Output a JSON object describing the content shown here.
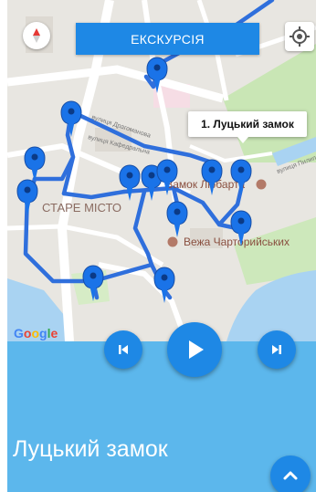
{
  "toolbar": {
    "tour_label": "ЕКСКУРСІЯ",
    "compass_icon": "compass-icon",
    "locate_icon": "my-location-icon"
  },
  "map": {
    "callout_label": "1. Луцький замок",
    "labels": {
      "old_town": "СТАРЕ МІСТО",
      "lubart_castle": "Замок Любарта",
      "czartoryski_tower": "Вежа Чарторийських"
    },
    "streets": [
      "вулиця Драгоманова",
      "вулиця Кафедральна",
      "вулиця Пилипа Орлика"
    ],
    "google": [
      "G",
      "o",
      "o",
      "g",
      "l",
      "e"
    ],
    "pin_count": 14,
    "route_color": "#2f6fdc",
    "pin_color": "#1a73e8"
  },
  "player": {
    "prev_icon": "skip-previous-icon",
    "play_icon": "play-icon",
    "next_icon": "skip-next-icon",
    "expand_icon": "chevron-up-icon"
  },
  "panel": {
    "title": "Луцький замок",
    "background": "#5cb7ec"
  }
}
